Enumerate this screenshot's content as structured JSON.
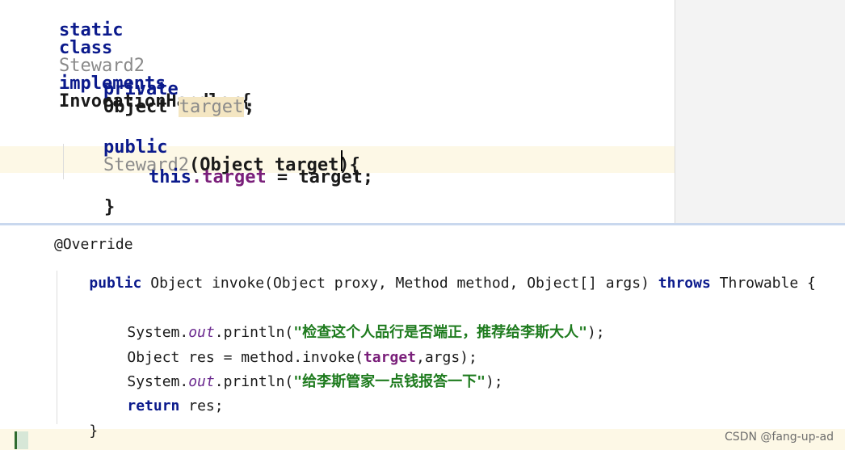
{
  "top": {
    "l1": {
      "kw1": "static",
      "kw2": "class",
      "cls": "Steward2",
      "kw3": "implements",
      "iface": "InvocationHandler{"
    },
    "l2": {
      "kw": "private",
      "type": "Object",
      "field": "target",
      "end": ";"
    },
    "l3": {
      "kw": "public",
      "ctor": "Steward2",
      "sig": "(Object target){"
    },
    "l4": {
      "kw": "this",
      "field": ".target",
      "rest": " = target;"
    },
    "l5": {
      "brace": "}"
    }
  },
  "bottom": {
    "ann": "@Override",
    "sig": {
      "kw": "public",
      "text1": " Object invoke(Object proxy, Method method, Object[] args) ",
      "kw2": "throws",
      "text2": " Throwable {"
    },
    "p1": {
      "pre": "System.",
      "out": "out",
      "mid": ".println(",
      "str": "\"检查这个人品行是否端正，推荐给李斯大人\"",
      "end": ");"
    },
    "p2": {
      "pre": "Object res = method.invoke(",
      "field": "target",
      "end": ",args);"
    },
    "p3": {
      "pre": "System.",
      "out": "out",
      "mid": ".println(",
      "str": "\"给李斯管家一点钱报答一下\"",
      "end": ");"
    },
    "p4": {
      "kw": "return",
      "rest": " res;"
    },
    "p5": {
      "brace": "}"
    }
  },
  "watermark": "CSDN @fang-up-ad"
}
